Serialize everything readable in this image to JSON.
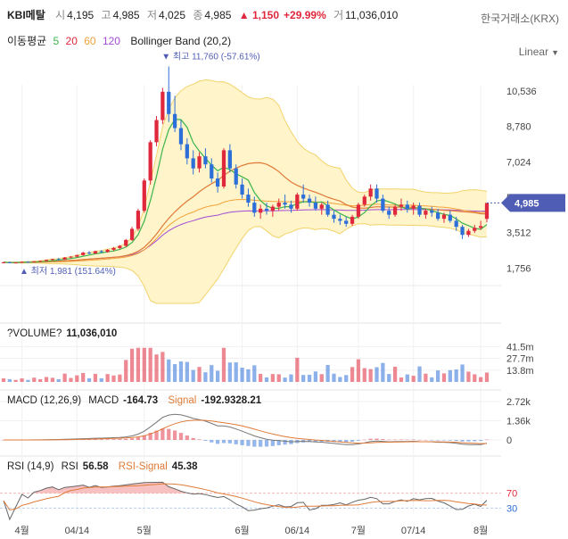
{
  "header": {
    "name": "KBI메탈",
    "open_label": "시",
    "open": "4,195",
    "high_label": "고",
    "high": "4,985",
    "low_label": "저",
    "low": "4,025",
    "close_label": "종",
    "close": "4,985",
    "change": "▲ 1,150",
    "change_pct": "+29.99%",
    "volume_label": "거",
    "volume": "11,036,010",
    "exchange": "한국거래소(KRX)"
  },
  "ma": {
    "label": "이동평균",
    "p5": "5",
    "p20": "20",
    "p60": "60",
    "p120": "120",
    "bollinger": "Bollinger Band (20,2)"
  },
  "scale_button": "Linear",
  "colors": {
    "up": "#e0283c",
    "down": "#2d6fd8",
    "ma5": "#3cb44b",
    "ma20": "#e07b39",
    "ma60": "#f2a33a",
    "ma120": "#a24bd6",
    "bb_fill": "#fff3c4",
    "bb_line": "#f2d36b",
    "price_tag": "#4f5db5"
  },
  "annotations": {
    "max": "▼ 최고 11,760 (-57.61%)",
    "min": "▲ 최저 1,981 (151.64%)",
    "current": "4,985"
  },
  "volume_pane": {
    "label": "?VOLUME?",
    "value": "11,036,010"
  },
  "macd_pane": {
    "label": "MACD (12,26,9)",
    "macd_label": "MACD",
    "macd_value": "-164.73",
    "signal_label": "Signal",
    "signal_value": "-192.9328.21"
  },
  "rsi_pane": {
    "label": "RSI (14,9)",
    "rsi_label": "RSI",
    "rsi_value": "56.58",
    "signal_label": "RSI-Signal",
    "signal_value": "45.38"
  },
  "chart_data": {
    "type": "candlestick",
    "price_axis_ticks": [
      "10,536",
      "8,780",
      "7,024",
      "5,268",
      "3,512",
      "1,756"
    ],
    "price_axis_values": [
      10536,
      8780,
      7024,
      5268,
      3512,
      1756
    ],
    "price_range": [
      0,
      12400
    ],
    "volume_axis_ticks": [
      "41.5m",
      "27.7m",
      "13.8m"
    ],
    "volume_axis_values": [
      41.5,
      27.7,
      13.8
    ],
    "macd_axis_ticks": [
      "2.72k",
      "1.36k",
      "0"
    ],
    "macd_axis_values": [
      2720,
      1360,
      0
    ],
    "rsi_axis_ticks": [
      "70",
      "30"
    ],
    "rsi_axis_values": [
      70,
      30
    ],
    "x_tick_labels": [
      "4월",
      "04/14",
      "5월",
      "6월",
      "06/14",
      "7월",
      "07/14",
      "8월"
    ],
    "x_tick_index": [
      3,
      12,
      23,
      39,
      48,
      58,
      67,
      78
    ],
    "candles": [
      [
        2010,
        2060,
        1990,
        2040
      ],
      [
        2040,
        2070,
        2000,
        2020
      ],
      [
        2020,
        2050,
        1995,
        2030
      ],
      [
        2030,
        2080,
        2010,
        2060
      ],
      [
        2060,
        2090,
        2030,
        2050
      ],
      [
        2050,
        2100,
        2030,
        2090
      ],
      [
        2090,
        2130,
        2060,
        2110
      ],
      [
        2110,
        2180,
        2080,
        2160
      ],
      [
        2160,
        2220,
        2130,
        2200
      ],
      [
        2200,
        2260,
        2150,
        2180
      ],
      [
        2180,
        2300,
        2160,
        2280
      ],
      [
        2280,
        2350,
        2240,
        2320
      ],
      [
        2320,
        2420,
        2280,
        2400
      ],
      [
        2400,
        2560,
        2360,
        2520
      ],
      [
        2520,
        2600,
        2430,
        2480
      ],
      [
        2480,
        2620,
        2450,
        2590
      ],
      [
        2590,
        2650,
        2500,
        2550
      ],
      [
        2550,
        2700,
        2520,
        2660
      ],
      [
        2660,
        2800,
        2600,
        2750
      ],
      [
        2750,
        2900,
        2680,
        2860
      ],
      [
        2860,
        3200,
        2800,
        3150
      ],
      [
        3150,
        3800,
        3100,
        3700
      ],
      [
        3700,
        4700,
        3600,
        4600
      ],
      [
        4600,
        6200,
        4500,
        6100
      ],
      [
        6100,
        8100,
        5900,
        8000
      ],
      [
        8000,
        9300,
        7800,
        9100
      ],
      [
        9100,
        10700,
        8900,
        10500
      ],
      [
        10500,
        11760,
        9000,
        9400
      ],
      [
        9400,
        10300,
        8500,
        8700
      ],
      [
        8700,
        9100,
        7600,
        7900
      ],
      [
        7900,
        8200,
        6900,
        7200
      ],
      [
        7200,
        7600,
        6400,
        6700
      ],
      [
        6700,
        7500,
        6500,
        7300
      ],
      [
        7300,
        7700,
        6700,
        6900
      ],
      [
        6900,
        7200,
        6000,
        6200
      ],
      [
        6200,
        6500,
        5500,
        5800
      ],
      [
        5800,
        7700,
        5700,
        7600
      ],
      [
        7600,
        7900,
        6500,
        6700
      ],
      [
        6700,
        6900,
        5700,
        5900
      ],
      [
        5900,
        6200,
        5200,
        5400
      ],
      [
        5400,
        5700,
        4800,
        5000
      ],
      [
        5000,
        5300,
        4300,
        4500
      ],
      [
        4500,
        4900,
        4200,
        4700
      ],
      [
        4700,
        5000,
        4400,
        4600
      ],
      [
        4600,
        4900,
        4300,
        4800
      ],
      [
        4800,
        5200,
        4600,
        5000
      ],
      [
        5000,
        5400,
        4700,
        4900
      ],
      [
        4900,
        5100,
        4500,
        4700
      ],
      [
        4700,
        5500,
        4600,
        5400
      ],
      [
        5400,
        5900,
        5000,
        5200
      ],
      [
        5200,
        5400,
        4800,
        5000
      ],
      [
        5000,
        5300,
        4600,
        4700
      ],
      [
        4700,
        5000,
        4400,
        4900
      ],
      [
        4900,
        5100,
        4300,
        4400
      ],
      [
        4400,
        4600,
        4000,
        4200
      ],
      [
        4200,
        4400,
        3900,
        4100
      ],
      [
        4100,
        4300,
        3800,
        3950
      ],
      [
        3950,
        4400,
        3850,
        4300
      ],
      [
        4300,
        5000,
        4200,
        4900
      ],
      [
        4900,
        5400,
        4800,
        5300
      ],
      [
        5300,
        5900,
        5100,
        5700
      ],
      [
        5700,
        5900,
        5000,
        5200
      ],
      [
        5200,
        5400,
        4500,
        4600
      ],
      [
        4600,
        4800,
        4200,
        4400
      ],
      [
        4400,
        4900,
        4300,
        4800
      ],
      [
        4800,
        5200,
        4600,
        4900
      ],
      [
        4900,
        5100,
        4500,
        4700
      ],
      [
        4700,
        5000,
        4400,
        4850
      ],
      [
        4850,
        5000,
        4300,
        4400
      ],
      [
        4400,
        4700,
        4200,
        4600
      ],
      [
        4600,
        4800,
        4300,
        4500
      ],
      [
        4500,
        4700,
        4100,
        4200
      ],
      [
        4200,
        4500,
        4000,
        4400
      ],
      [
        4400,
        4600,
        4000,
        4100
      ],
      [
        4100,
        4300,
        3600,
        3800
      ],
      [
        3800,
        3900,
        3200,
        3400
      ],
      [
        3400,
        3700,
        3300,
        3600
      ],
      [
        3600,
        3900,
        3500,
        3750
      ],
      [
        3750,
        4100,
        3650,
        3835
      ],
      [
        4195,
        4985,
        4025,
        4985
      ]
    ]
  }
}
